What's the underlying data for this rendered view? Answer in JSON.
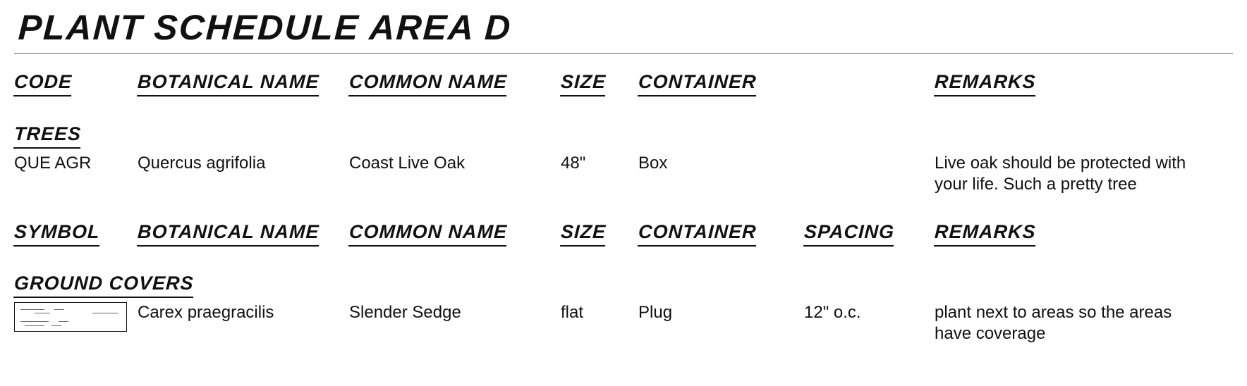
{
  "title": "PLANT SCHEDULE AREA D",
  "headers1": {
    "code": "CODE",
    "botanical": "BOTANICAL NAME",
    "common": "COMMON NAME",
    "size": "SIZE",
    "container": "CONTAINER",
    "remarks": "REMARKS"
  },
  "section1": "TREES",
  "trees_row": {
    "code": "QUE AGR",
    "botanical": "Quercus agrifolia",
    "common": "Coast Live Oak",
    "size": "48\"",
    "container": "Box",
    "remarks": "Live oak should be protected with your life. Such a pretty tree"
  },
  "headers2": {
    "symbol": "SYMBOL",
    "botanical": "BOTANICAL NAME",
    "common": "COMMON NAME",
    "size": "SIZE",
    "container": "CONTAINER",
    "spacing": "SPACING",
    "remarks": "REMARKS"
  },
  "section2": "GROUND COVERS",
  "gc_row": {
    "botanical": "Carex praegracilis",
    "common": "Slender Sedge",
    "size": "flat",
    "container": "Plug",
    "spacing": "12\" o.c.",
    "remarks": "plant next to areas so the areas have coverage"
  }
}
